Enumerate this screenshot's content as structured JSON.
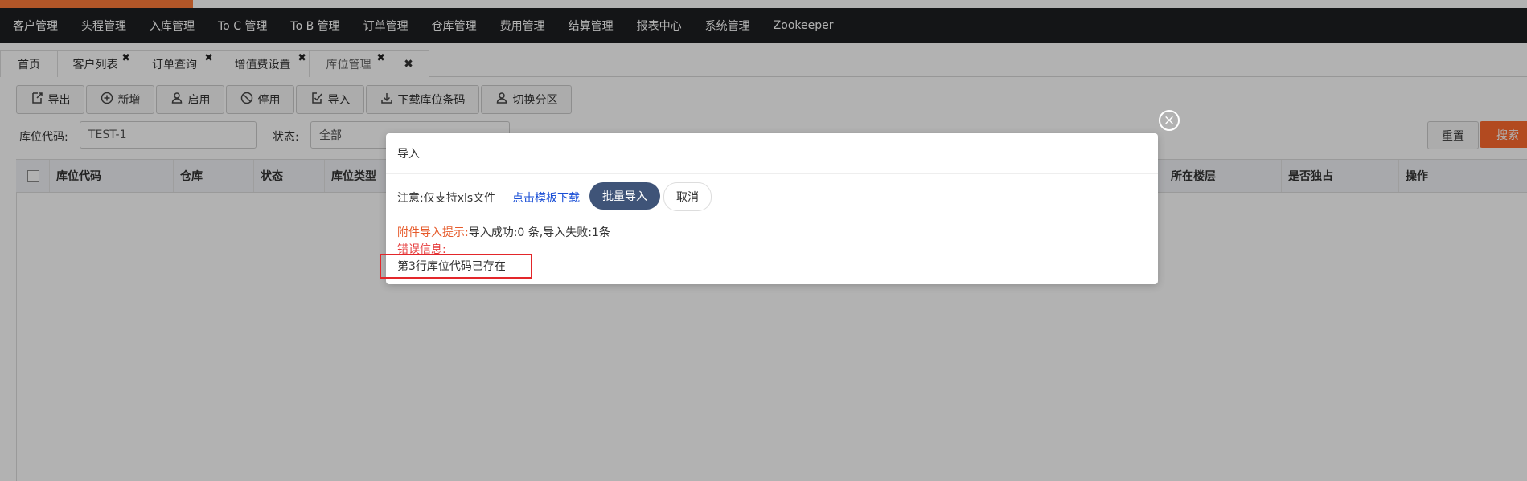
{
  "top_nav": [
    "客户管理",
    "头程管理",
    "入库管理",
    "To C 管理",
    "To B 管理",
    "订单管理",
    "仓库管理",
    "费用管理",
    "结算管理",
    "报表中心",
    "系统管理",
    "Zookeeper"
  ],
  "tabs": [
    {
      "label": "首页",
      "closable": false
    },
    {
      "label": "客户列表",
      "closable": true
    },
    {
      "label": "订单查询",
      "closable": true
    },
    {
      "label": "增值费设置",
      "closable": true
    },
    {
      "label": "库位管理",
      "closable": true,
      "active": true
    }
  ],
  "tab_close_symbol": "✖",
  "toolbar": [
    {
      "label": "导出",
      "icon": "export-icon"
    },
    {
      "label": "新增",
      "icon": "plus-circle-icon"
    },
    {
      "label": "启用",
      "icon": "user-icon"
    },
    {
      "label": "停用",
      "icon": "ban-icon"
    },
    {
      "label": "导入",
      "icon": "import-icon"
    },
    {
      "label": "下载库位条码",
      "icon": "download-icon"
    },
    {
      "label": "切换分区",
      "icon": "user-switch-icon"
    }
  ],
  "filters": {
    "location_code_label": "库位代码:",
    "location_code_value": "TEST-1",
    "status_label": "状态:",
    "status_value": "全部"
  },
  "buttons": {
    "reset": "重置",
    "search": "搜索"
  },
  "table": {
    "columns": [
      "库位代码",
      "仓库",
      "状态",
      "库位类型",
      "所在楼层",
      "是否独占",
      "操作"
    ]
  },
  "modal": {
    "title": "导入",
    "note": "注意:仅支持xls文件",
    "template_link": "点击模板下载",
    "batch_import": "批量导入",
    "cancel": "取消",
    "result_hint": "附件导入提示:",
    "result_msg": "导入成功:0 条,导入失败:1条",
    "error_label": "错误信息:",
    "error_msg": "第3行库位代码已存在",
    "close_symbol": "×"
  },
  "colors": {
    "accent": "#ff7b3a",
    "topbar": "#1d1f22",
    "primary_button": "#3f5478",
    "search": "#ff6a2e",
    "error": "#e63b3b"
  }
}
